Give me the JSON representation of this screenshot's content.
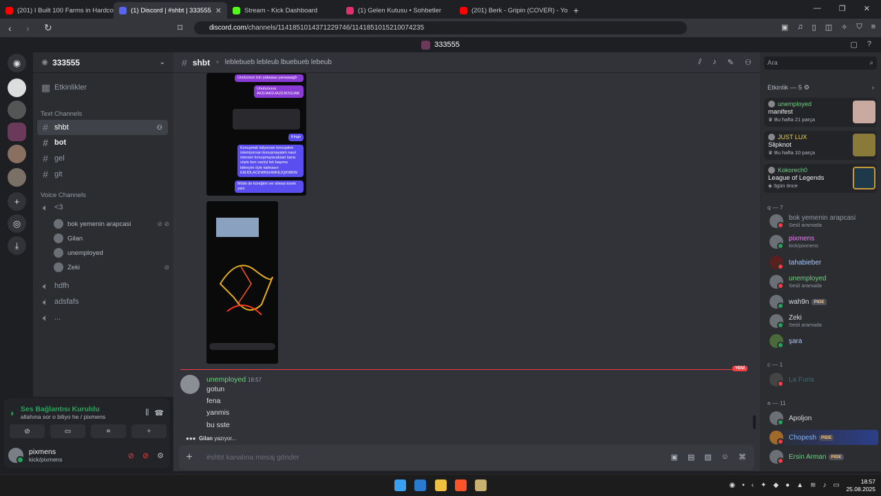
{
  "browser": {
    "tabs": [
      {
        "label": "(201) I Built 100 Farms in Hardcore M",
        "color": "#ff0000"
      },
      {
        "label": "(1) Discord | #shbt | 333555",
        "color": "#5865f2"
      },
      {
        "label": "Stream - Kick Dashboard",
        "color": "#53fc18"
      },
      {
        "label": "(1) Gelen Kutusu • Sohbetler",
        "color": "#e1306c"
      },
      {
        "label": "(201) Berk - Gripin (COVER) - You",
        "color": "#ff0000"
      }
    ],
    "new_tab": "+",
    "url_host": "discord.com",
    "url_path": "/channels/1141851014371229746/1141851015210074235"
  },
  "window_title": "333555",
  "server": {
    "name": "333555",
    "events": "Etkinlikler"
  },
  "categories": {
    "text": "Text Channels",
    "voice": "Voice Channels"
  },
  "channels": {
    "text": [
      {
        "name": "shbt"
      },
      {
        "name": "bot"
      },
      {
        "name": "gel"
      },
      {
        "name": "git"
      }
    ],
    "voice": [
      {
        "name": "<3"
      },
      {
        "name": "hdfh"
      },
      {
        "name": "adsfafs"
      },
      {
        "name": "..."
      }
    ],
    "voice_users": [
      {
        "name": "bok yemenin arapcasi"
      },
      {
        "name": "Gilan"
      },
      {
        "name": "unemployed"
      },
      {
        "name": "Zeki"
      }
    ]
  },
  "voice_panel": {
    "status": "Ses Bağlantısı Kuruldu",
    "sub": "allahına sor o biliyo he / pixmens"
  },
  "me": {
    "name": "pixmens",
    "status": "kick/pixmens"
  },
  "channel_header": {
    "name": "shbt",
    "topic": "leblebueb lebleub lbuebueb lebeub"
  },
  "chat": {
    "new_label": "YENİ",
    "message": {
      "author": "unemployed",
      "time": "18:57",
      "lines": [
        "gotun",
        "fena",
        "yanmis",
        "bu sste"
      ]
    },
    "typing_user": "Gilan",
    "typing_suffix": "yazıyor...",
    "input_placeholder": "#shbt kanalına mesaj gönder"
  },
  "screenshot_bubbles": [
    "Unutursun icin yabaaaa yanaaaagh",
    "Unutursuuu AKDJAKDJAJDJKSSJAK",
    "Kingo",
    "Konuşmak istiyorsan konuşalım istemiyorsan konuşmayalım nasıl istersen konuşmayacaksan bana söyle ben vazlıyl tek başıma bitireyim öyle kalmasın EMJDLACKWKEHWKEJQKWKW",
    "Möde de küreğimi ver silmas kürek yani"
  ],
  "right": {
    "search_placeholder": "Ara",
    "activity_header": "Etkinlik — 5",
    "activities": [
      {
        "user": "unemployed",
        "title": "manifest",
        "sub": "Bu hafta 21 parça",
        "art": "#c9a9a0"
      },
      {
        "user": "JUST LUX",
        "title": "Slipknot",
        "sub": "Bu hafta 10 parça",
        "art": "#8a7a3a"
      },
      {
        "user": "Kokorech0",
        "title": "League of Legends",
        "sub": "3gün önce",
        "art": "#c89b3c"
      }
    ],
    "groups": [
      {
        "label": "q — 7",
        "members": [
          {
            "name": "bok yemenin arapcasi",
            "sub": "Sesli aramada",
            "color": "#949ba4",
            "status": "dnd"
          },
          {
            "name": "pixmens",
            "sub": "kick/pixmens",
            "color": "#f47fff",
            "status": "on"
          },
          {
            "name": "tahabieber",
            "sub": "",
            "color": "#a8c8ff",
            "status": "dnd"
          },
          {
            "name": "unemployed",
            "sub": "Sesli aramada",
            "color": "#6ed482",
            "status": "dnd"
          },
          {
            "name": "wah9n",
            "sub": "",
            "color": "#f2f3f5",
            "status": "on",
            "badge": "PIDE"
          },
          {
            "name": "Zeki",
            "sub": "Sesli aramada",
            "color": "#f2f3f5",
            "status": "on"
          },
          {
            "name": "şara",
            "sub": "",
            "color": "#a8c8ff",
            "status": "on"
          }
        ]
      },
      {
        "label": "c — 1",
        "members": [
          {
            "name": "La Furia",
            "sub": "",
            "color": "#3f6b70",
            "status": "dnd"
          }
        ]
      },
      {
        "label": "e — 11",
        "members": [
          {
            "name": "Apoljon",
            "sub": "",
            "color": "#f2f3f5",
            "status": "on"
          },
          {
            "name": "Chopesh",
            "sub": "",
            "color": "#7ab7ff",
            "status": "dnd",
            "badge": "PIDE"
          },
          {
            "name": "Ersin Arman",
            "sub": "",
            "color": "#6ed482",
            "status": "dnd",
            "badge": "PIDE"
          }
        ]
      }
    ]
  },
  "taskbar": {
    "time": "18:57",
    "date": "25.08.2025"
  }
}
